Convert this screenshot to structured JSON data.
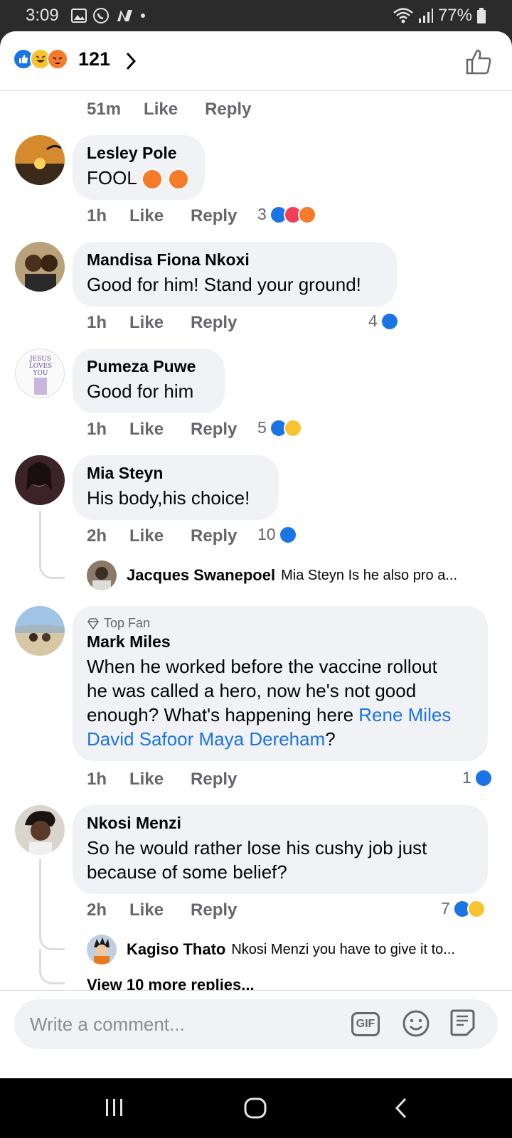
{
  "status_bar": {
    "time": "3:09",
    "battery": "77%"
  },
  "header": {
    "reaction_count": "121"
  },
  "top_meta": {
    "time": "51m",
    "like": "Like",
    "reply": "Reply"
  },
  "comments": [
    {
      "name": "Lesley Pole",
      "text": "FOOL",
      "time": "1h",
      "like": "Like",
      "reply": "Reply",
      "reactions": "3"
    },
    {
      "name": "Mandisa Fiona Nkoxi",
      "text": "Good for him! Stand your ground!",
      "time": "1h",
      "like": "Like",
      "reply": "Reply",
      "reactions": "4"
    },
    {
      "name": "Pumeza Puwe",
      "text": "Good for him",
      "time": "1h",
      "like": "Like",
      "reply": "Reply",
      "reactions": "5",
      "avatar_text": "JESUS LOVES YOU"
    },
    {
      "name": "Mia Steyn",
      "text": "His body,his choice!",
      "time": "2h",
      "like": "Like",
      "reply": "Reply",
      "reactions": "10",
      "reply_preview": {
        "name": "Jacques Swanepoel",
        "text": "Mia Steyn Is he also pro a..."
      }
    },
    {
      "badge": "Top Fan",
      "name": "Mark Miles",
      "text_lines": [
        "When he worked before the vaccine rollout",
        "he was called a hero, now he's not good",
        "enough? What's happening here "
      ],
      "link1": "Rene Miles",
      "link2": "David Safoor Maya Dereham",
      "text_end": "?",
      "time": "1h",
      "like": "Like",
      "reply": "Reply",
      "reactions": "1"
    },
    {
      "name": "Nkosi Menzi",
      "text_lines": [
        "So he would rather lose his cushy job just",
        "because of some belief?"
      ],
      "time": "2h",
      "like": "Like",
      "reply": "Reply",
      "reactions": "7",
      "reply_preview": {
        "name": "Kagiso Thato",
        "text": "Nkosi Menzi you have to give it to..."
      },
      "view_more": "View 10 more replies..."
    }
  ],
  "composer": {
    "placeholder": "Write a comment...",
    "gif": "GIF"
  },
  "colors": {
    "like": "#1b74e4",
    "love": "#f33e58",
    "angry": "#f57a2a",
    "haha": "#f7c32e",
    "bubble": "#f0f2f5"
  },
  "icons": [
    "gallery-icon",
    "whatsapp-icon",
    "n-app-icon",
    "wifi-icon",
    "signal-icon",
    "battery-icon",
    "like-reaction-icon",
    "haha-reaction-icon",
    "angry-reaction-icon",
    "love-reaction-icon",
    "wow-reaction-icon",
    "care-reaction-icon",
    "chevron-right-icon",
    "thumbs-up-outline-icon",
    "emoji-icon",
    "sticker-icon",
    "recents-nav-icon",
    "home-nav-icon",
    "back-nav-icon",
    "diamond-icon"
  ]
}
